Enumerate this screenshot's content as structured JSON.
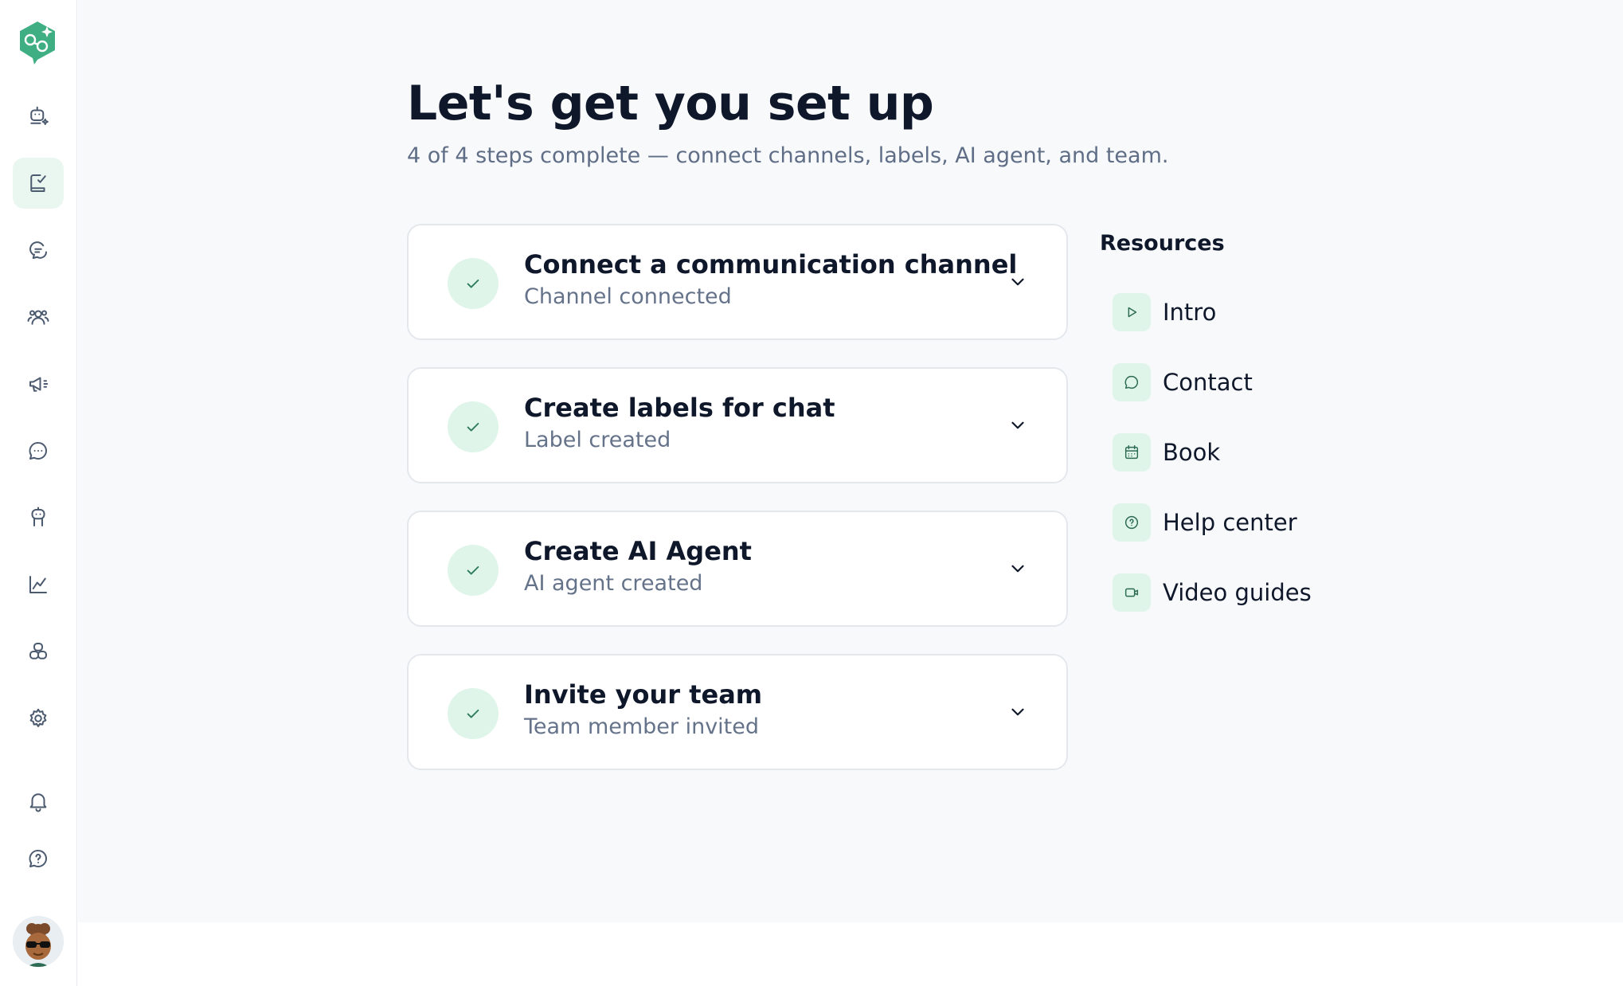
{
  "sidebar": {
    "nav": [
      {
        "name": "ai-assistant-icon",
        "active": false
      },
      {
        "name": "onboarding-checklist-icon",
        "active": true
      },
      {
        "name": "conversations-icon",
        "active": false
      },
      {
        "name": "contacts-icon",
        "active": false
      },
      {
        "name": "campaigns-icon",
        "active": false
      },
      {
        "name": "chat-icon",
        "active": false
      },
      {
        "name": "ai-agent-icon",
        "active": false
      },
      {
        "name": "reports-icon",
        "active": false
      },
      {
        "name": "integrations-icon",
        "active": false
      },
      {
        "name": "settings-icon",
        "active": false
      },
      {
        "name": "notifications-icon",
        "active": false
      },
      {
        "name": "help-icon",
        "active": false
      }
    ]
  },
  "main": {
    "title": "Let's get you set up",
    "subtitle": "4 of 4 steps complete — connect channels, labels, AI agent, and team.",
    "steps": [
      {
        "title": "Connect a communication channel",
        "status": "Channel connected"
      },
      {
        "title": "Create labels for chat",
        "status": "Label created"
      },
      {
        "title": "Create AI Agent",
        "status": "AI agent created"
      },
      {
        "title": "Invite your team",
        "status": "Team member invited"
      }
    ],
    "resources": {
      "heading": "Resources",
      "items": [
        {
          "label": "Intro",
          "icon": "play-icon"
        },
        {
          "label": "Contact",
          "icon": "chat-bubble-icon"
        },
        {
          "label": "Book",
          "icon": "calendar-icon"
        },
        {
          "label": "Help center",
          "icon": "question-icon"
        },
        {
          "label": "Video guides",
          "icon": "video-icon"
        }
      ]
    }
  },
  "colors": {
    "accent": "#2d7a5b",
    "accent_bg": "#dff5ea",
    "page_bg": "#f8f9fb"
  }
}
